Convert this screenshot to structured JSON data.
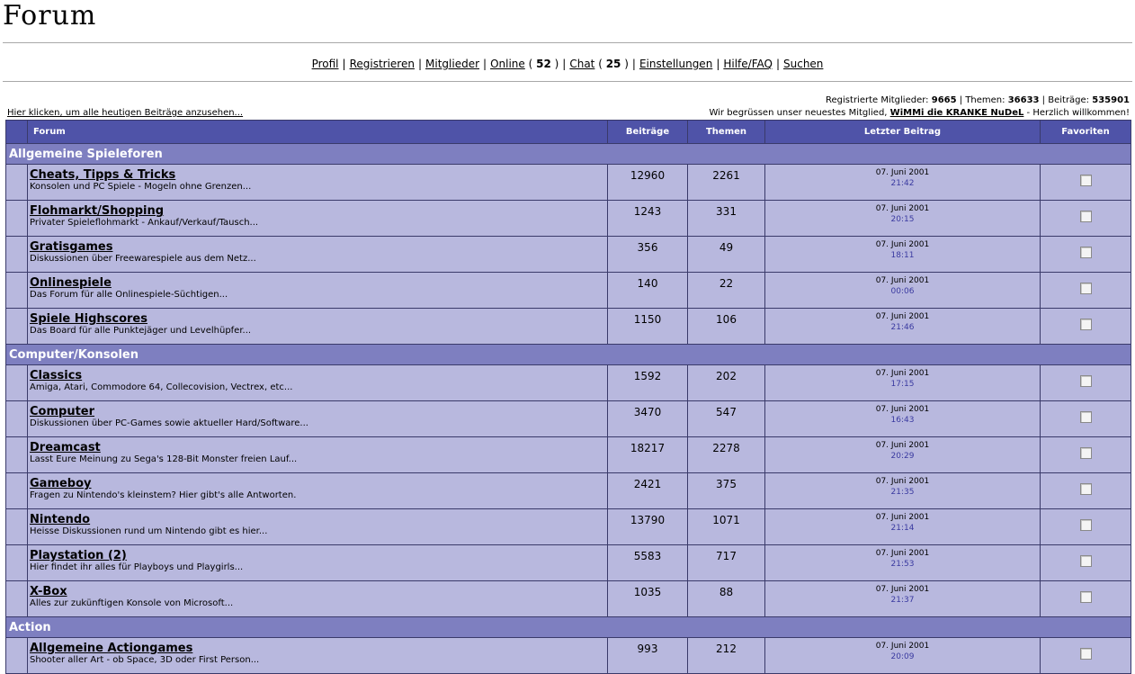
{
  "page_title": "Forum",
  "nav": {
    "profil": "Profil",
    "registrieren": "Registrieren",
    "mitglieder": "Mitglieder",
    "online": "Online",
    "online_count": "52",
    "chat": "Chat",
    "chat_count": "25",
    "einstellungen": "Einstellungen",
    "hilfe": "Hilfe/FAQ",
    "suchen": "Suchen"
  },
  "stats": {
    "members_label": "Registrierte Mitglieder:",
    "members": "9665",
    "topics_label": "Themen:",
    "topics": "36633",
    "posts_label": "Beiträge:",
    "posts": "535901"
  },
  "welcome": {
    "prefix": "Wir begrüssen unser neuestes Mitglied,",
    "member": "WiMMi die KRANKE NuDeL",
    "suffix": "- Herzlich willkommen!"
  },
  "today_link": "Hier klicken, um alle heutigen Beiträge anzusehen...",
  "headers": {
    "forum": "Forum",
    "posts": "Beiträge",
    "topics": "Themen",
    "last": "Letzter Beitrag",
    "fav": "Favoriten"
  },
  "categories": [
    {
      "name": "Allgemeine Spieleforen",
      "forums": [
        {
          "name": "Cheats, Tipps & Tricks",
          "desc": "Konsolen und PC Spiele - Mogeln ohne Grenzen...",
          "posts": "12960",
          "topics": "2261",
          "date": "07. Juni 2001",
          "time": "21:42"
        },
        {
          "name": "Flohmarkt/Shopping",
          "desc": "Privater Spieleflohmarkt - Ankauf/Verkauf/Tausch...",
          "posts": "1243",
          "topics": "331",
          "date": "07. Juni 2001",
          "time": "20:15"
        },
        {
          "name": "Gratisgames",
          "desc": "Diskussionen über Freewarespiele aus dem Netz...",
          "posts": "356",
          "topics": "49",
          "date": "07. Juni 2001",
          "time": "18:11"
        },
        {
          "name": "Onlinespiele",
          "desc": "Das Forum für alle Onlinespiele-Süchtigen...",
          "posts": "140",
          "topics": "22",
          "date": "07. Juni 2001",
          "time": "00:06"
        },
        {
          "name": "Spiele Highscores",
          "desc": "Das Board für alle Punktejäger und Levelhüpfer...",
          "posts": "1150",
          "topics": "106",
          "date": "07. Juni 2001",
          "time": "21:46"
        }
      ]
    },
    {
      "name": "Computer/Konsolen",
      "forums": [
        {
          "name": "Classics",
          "desc": "Amiga, Atari, Commodore 64, Collecovision, Vectrex, etc...",
          "posts": "1592",
          "topics": "202",
          "date": "07. Juni 2001",
          "time": "17:15"
        },
        {
          "name": "Computer",
          "desc": "Diskussionen über PC-Games sowie aktueller Hard/Software...",
          "posts": "3470",
          "topics": "547",
          "date": "07. Juni 2001",
          "time": "16:43"
        },
        {
          "name": "Dreamcast",
          "desc": "Lasst Eure Meinung zu Sega's 128-Bit Monster freien Lauf...",
          "posts": "18217",
          "topics": "2278",
          "date": "07. Juni 2001",
          "time": "20:29"
        },
        {
          "name": "Gameboy",
          "desc": "Fragen zu Nintendo's kleinstem? Hier gibt's alle Antworten.",
          "posts": "2421",
          "topics": "375",
          "date": "07. Juni 2001",
          "time": "21:35"
        },
        {
          "name": "Nintendo",
          "desc": "Heisse Diskussionen rund um Nintendo gibt es hier...",
          "posts": "13790",
          "topics": "1071",
          "date": "07. Juni 2001",
          "time": "21:14"
        },
        {
          "name": "Playstation (2)",
          "desc": "Hier findet ihr alles für Playboys und Playgirls...",
          "posts": "5583",
          "topics": "717",
          "date": "07. Juni 2001",
          "time": "21:53"
        },
        {
          "name": "X-Box",
          "desc": "Alles zur zukünftigen Konsole von Microsoft...",
          "posts": "1035",
          "topics": "88",
          "date": "07. Juni 2001",
          "time": "21:37"
        }
      ]
    },
    {
      "name": "Action",
      "forums": [
        {
          "name": "Allgemeine Actiongames",
          "desc": "Shooter aller Art - ob Space, 3D oder First Person...",
          "posts": "993",
          "topics": "212",
          "date": "07. Juni 2001",
          "time": "20:09"
        }
      ]
    }
  ]
}
